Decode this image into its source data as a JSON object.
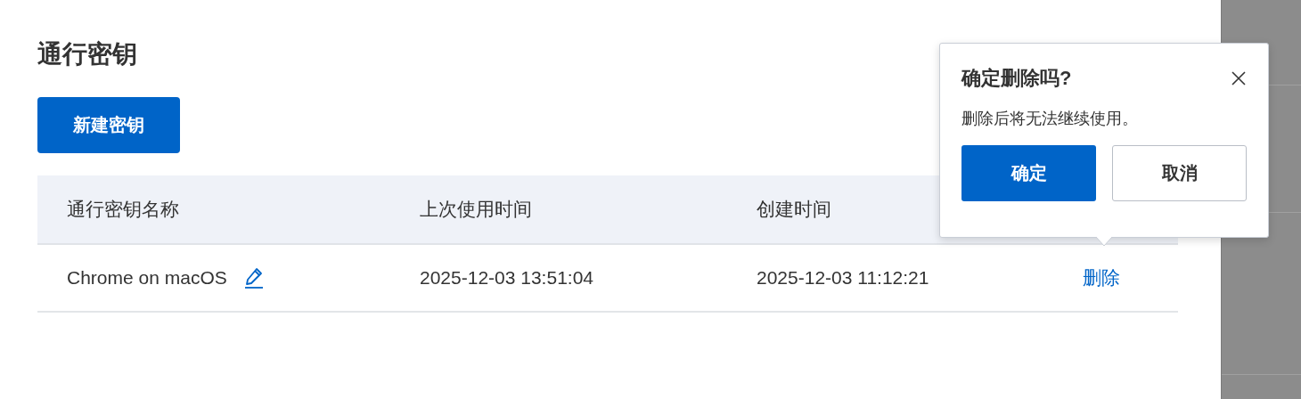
{
  "page": {
    "title": "通行密钥",
    "new_button": "新建密钥"
  },
  "table": {
    "columns": [
      "通行密钥名称",
      "上次使用时间",
      "创建时间"
    ],
    "rows": [
      {
        "name": "Chrome on macOS",
        "last_used": "2025-12-03 13:51:04",
        "created": "2025-12-03 11:12:21",
        "action": "删除"
      }
    ]
  },
  "popconfirm": {
    "title": "确定删除吗?",
    "message": "删除后将无法继续使用。",
    "confirm": "确定",
    "cancel": "取消"
  }
}
